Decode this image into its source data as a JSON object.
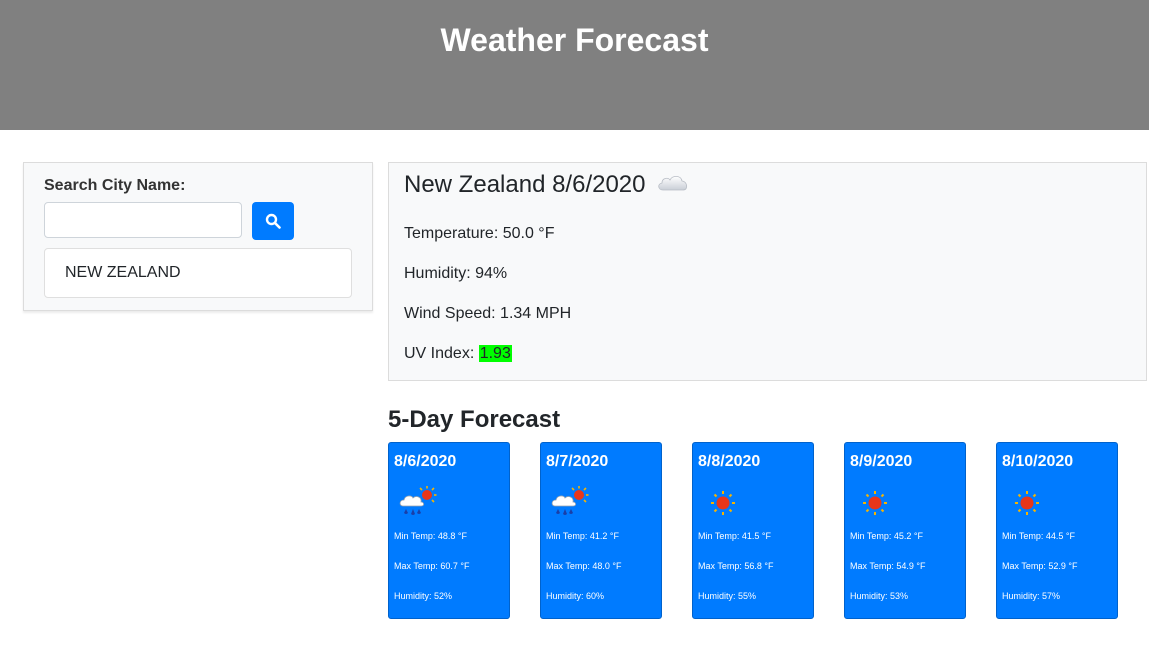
{
  "header": {
    "title": "Weather Forecast"
  },
  "search": {
    "label": "Search City Name:",
    "input_value": "",
    "placeholder": "",
    "history": [
      "NEW ZEALAND"
    ]
  },
  "current": {
    "title": "New Zealand 8/6/2020",
    "icon": "cloud-icon",
    "temperature": "Temperature: 50.0 °F",
    "humidity": "Humidity: 94%",
    "wind": "Wind Speed: 1.34 MPH",
    "uv_label": "UV Index: ",
    "uv_value": "1.93",
    "uv_color": "#00ff00"
  },
  "forecast": {
    "heading": "5-Day Forecast",
    "days": [
      {
        "date": "8/6/2020",
        "icon": "rain-sun-icon",
        "min": "Min Temp: 48.8 °F",
        "max": "Max Temp: 60.7 °F",
        "humidity": "Humidity: 52%"
      },
      {
        "date": "8/7/2020",
        "icon": "rain-sun-icon",
        "min": "Min Temp: 41.2 °F",
        "max": "Max Temp: 48.0 °F",
        "humidity": "Humidity: 60%"
      },
      {
        "date": "8/8/2020",
        "icon": "sun-icon",
        "min": "Min Temp: 41.5 °F",
        "max": "Max Temp: 56.8 °F",
        "humidity": "Humidity: 55%"
      },
      {
        "date": "8/9/2020",
        "icon": "sun-icon",
        "min": "Min Temp: 45.2 °F",
        "max": "Max Temp: 54.9 °F",
        "humidity": "Humidity: 53%"
      },
      {
        "date": "8/10/2020",
        "icon": "sun-icon",
        "min": "Min Temp: 44.5 °F",
        "max": "Max Temp: 52.9 °F",
        "humidity": "Humidity: 57%"
      }
    ]
  },
  "colors": {
    "header_bg": "#808080",
    "accent": "#007bff",
    "uv_low": "#00ff00"
  }
}
